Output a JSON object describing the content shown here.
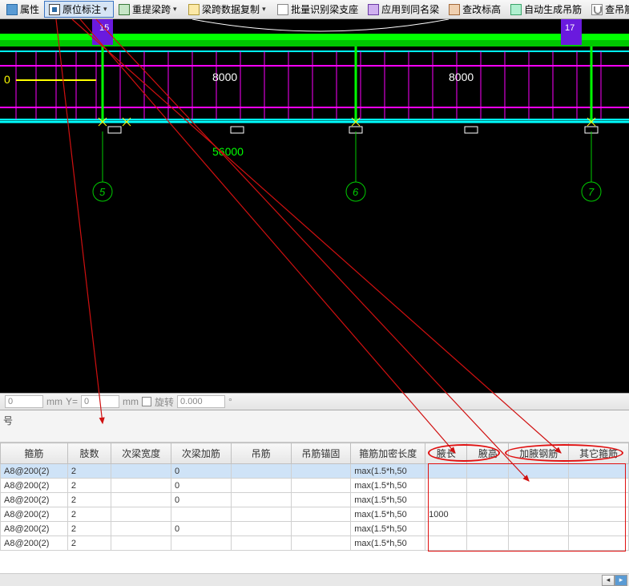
{
  "toolbar": {
    "btn_prop": "属性",
    "btn_annot": "原位标注",
    "btn_retrieve": "重提梁跨",
    "btn_copy": "梁跨数据复制",
    "btn_batch": "批量识别梁支座",
    "btn_apply": "应用到同名梁",
    "btn_elev": "查改标高",
    "btn_gen": "自动生成吊筋",
    "btn_view": "查吊筋"
  },
  "viewport": {
    "dim_label": "56000",
    "span_a": "8000",
    "span_b": "8000",
    "left_zero": "0",
    "axis_5": "5",
    "axis_6": "6",
    "axis_7": "7",
    "grid_a": "15",
    "grid_b": "17"
  },
  "coord": {
    "x_val": "0",
    "x_unit": "mm",
    "y_lbl": "Y=",
    "y_val": "0",
    "y_unit": "mm",
    "rot_lbl": "旋转",
    "rot_val": "0.000"
  },
  "panel_label": "号",
  "columns": [
    "箍筋",
    "肢数",
    "次梁宽度",
    "次梁加筋",
    "吊筋",
    "吊筋锚固",
    "箍筋加密长度",
    "腋长",
    "腋高",
    "加腋钢筋",
    "其它箍筋"
  ],
  "rows": [
    {
      "c0": "A8@200(2)",
      "c1": "2",
      "c2": "",
      "c3": "0",
      "c4": "",
      "c5": "",
      "c6": "max(1.5*h,50",
      "c7": "",
      "c8": "",
      "c9": "",
      "c10": "",
      "sel": true
    },
    {
      "c0": "A8@200(2)",
      "c1": "2",
      "c2": "",
      "c3": "0",
      "c4": "",
      "c5": "",
      "c6": "max(1.5*h,50",
      "c7": "",
      "c8": "",
      "c9": "",
      "c10": ""
    },
    {
      "c0": "A8@200(2)",
      "c1": "2",
      "c2": "",
      "c3": "0",
      "c4": "",
      "c5": "",
      "c6": "max(1.5*h,50",
      "c7": "",
      "c8": "",
      "c9": "",
      "c10": ""
    },
    {
      "c0": "A8@200(2)",
      "c1": "2",
      "c2": "",
      "c3": "",
      "c4": "",
      "c5": "",
      "c6": "max(1.5*h,50",
      "c7": "1000",
      "c8": "",
      "c9": "",
      "c10": ""
    },
    {
      "c0": "A8@200(2)",
      "c1": "2",
      "c2": "",
      "c3": "0",
      "c4": "",
      "c5": "",
      "c6": "max(1.5*h,50",
      "c7": "",
      "c8": "",
      "c9": "",
      "c10": ""
    },
    {
      "c0": "A8@200(2)",
      "c1": "2",
      "c2": "",
      "c3": "",
      "c4": "",
      "c5": "",
      "c6": "max(1.5*h,50",
      "c7": "",
      "c8": "",
      "c9": "",
      "c10": ""
    }
  ]
}
